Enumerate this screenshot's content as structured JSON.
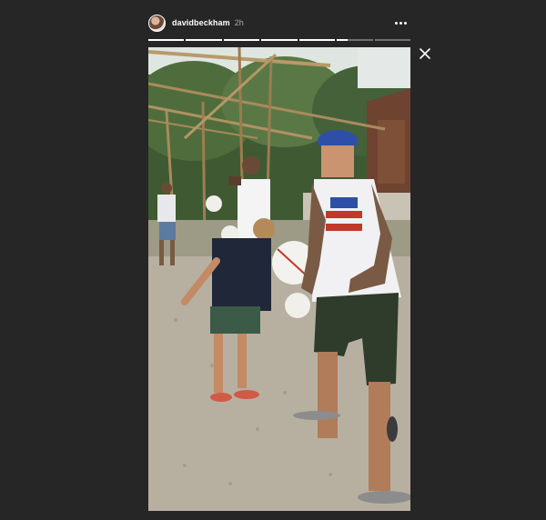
{
  "story": {
    "username": "davidbeckham",
    "timestamp": "2h",
    "segments": [
      1,
      1,
      1,
      1,
      1,
      0.3,
      0
    ]
  },
  "icons": {
    "more": "more-horizontal-icon",
    "close": "close-icon",
    "avatar": "profile-avatar"
  },
  "colors": {
    "background": "#262626",
    "text_primary": "#ffffff",
    "text_secondary": "#a8a8a8"
  }
}
